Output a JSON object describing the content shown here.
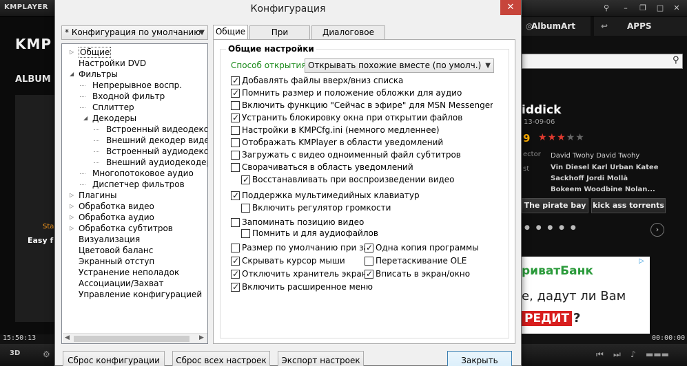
{
  "player": {
    "logo": "KMPLAYER",
    "big_logo": "KMP",
    "album_label": "ALBUM",
    "stat_text": "Sta",
    "easy_text": "Easy f",
    "time_left": "15:50:13",
    "time_right": "00:00:00",
    "tab_albumart": "AlbumArt",
    "tab_apps": "APPS",
    "movie_title": "iddick",
    "movie_date": "13-09-06",
    "rating": "9",
    "stars_on": 3,
    "stars_total": 5,
    "director_label": "ector",
    "director_value": "David Twohy David Twohy",
    "cast_label": "st",
    "cast_value": "Vin Diesel Karl Urban Katee Sackhoff Jordi Mollà Bokeem Woodbine Nolan...",
    "link_piratebay": "The pirate bay",
    "link_kat": "kick ass torrents",
    "ad_bank": "риватБанк",
    "ad_line1": "е, дадут ли Вам",
    "ad_credit": "РЕДИТ",
    "ad_q": "?",
    "ctrl_3d": "3D"
  },
  "dialog": {
    "title": "Конфигурация",
    "close_glyph": "✕",
    "preset": "* Конфигурация по умолчанию",
    "tree": [
      {
        "label": "Общие",
        "level": 0,
        "toggle": "▷"
      },
      {
        "label": "Настройки DVD",
        "level": 0,
        "toggle": ""
      },
      {
        "label": "Фильтры",
        "level": 0,
        "toggle": "◢"
      },
      {
        "label": "Непрерывное воспр.",
        "level": 1,
        "toggle": ""
      },
      {
        "label": "Входной фильтр",
        "level": 1,
        "toggle": ""
      },
      {
        "label": "Сплиттер",
        "level": 1,
        "toggle": ""
      },
      {
        "label": "Декодеры",
        "level": 1,
        "toggle": "◢"
      },
      {
        "label": "Встроенный видеодекоде",
        "level": 2,
        "toggle": ""
      },
      {
        "label": "Внешний декодер видео",
        "level": 2,
        "toggle": ""
      },
      {
        "label": "Встроенный аудиодекоде",
        "level": 2,
        "toggle": ""
      },
      {
        "label": "Внешний аудиодекодер",
        "level": 2,
        "toggle": ""
      },
      {
        "label": "Многопотоковое аудио",
        "level": 1,
        "toggle": ""
      },
      {
        "label": "Диспетчер фильтров",
        "level": 1,
        "toggle": ""
      },
      {
        "label": "Плагины",
        "level": 0,
        "toggle": "▷"
      },
      {
        "label": "Обработка видео",
        "level": 0,
        "toggle": "▷"
      },
      {
        "label": "Обработка аудио",
        "level": 0,
        "toggle": "▷"
      },
      {
        "label": "Обработка субтитров",
        "level": 0,
        "toggle": "▷"
      },
      {
        "label": "Визуализация",
        "level": 0,
        "toggle": ""
      },
      {
        "label": "Цветовой баланс",
        "level": 0,
        "toggle": ""
      },
      {
        "label": "Экранный отступ",
        "level": 0,
        "toggle": ""
      },
      {
        "label": "Устранение неполадок",
        "level": 0,
        "toggle": ""
      },
      {
        "label": "Ассоциации/Захват",
        "level": 0,
        "toggle": ""
      },
      {
        "label": "Управление конфигурацией",
        "level": 0,
        "toggle": ""
      }
    ],
    "tabs": [
      "Общие",
      "При запуске...",
      "Диалоговое окно"
    ],
    "group_title": "Общие настройки",
    "open_mode_label": "Способ открытия:",
    "open_mode_value": "Открывать похожие вместе (по умолч.)",
    "checkboxes": [
      {
        "label": "Добавлять файлы вверх/вниз списка",
        "checked": true
      },
      {
        "label": "Помнить размер и положение обложки для аудио",
        "checked": true
      },
      {
        "label": "Включить функцию \"Сейчас в эфире\" для MSN Messenger",
        "checked": false
      },
      {
        "label": "Устранить блокировку окна при открытии файлов",
        "checked": true
      },
      {
        "label": "Настройки в KMPCfg.ini (немного медленнее)",
        "checked": false
      },
      {
        "label": "Отображать KMPlayer в области уведомлений",
        "checked": false
      },
      {
        "label": "Загружать с видео одноименный файл субтитров",
        "checked": false
      },
      {
        "label": "Сворачиваться в область уведомлений",
        "checked": false
      },
      {
        "label": "Восстанавливать при воспроизведении видео",
        "checked": true
      },
      {
        "label": "Поддержка мультимедийных клавиатур",
        "checked": true
      },
      {
        "label": "Включить регулятор громкости",
        "checked": false
      },
      {
        "label": "Запоминать позицию видео",
        "checked": false
      },
      {
        "label": "Помнить и для аудиофайлов",
        "checked": false
      },
      {
        "label": "Размер по умолчанию при закр",
        "checked": false
      },
      {
        "label": "Одна копия программы",
        "checked": true
      },
      {
        "label": "Скрывать курсор мыши",
        "checked": true
      },
      {
        "label": "Перетаскивание OLE",
        "checked": false
      },
      {
        "label": "Отключить хранитель экрана",
        "checked": true
      },
      {
        "label": "Вписать в экран/окно",
        "checked": true
      },
      {
        "label": "Включить расширенное меню",
        "checked": true
      }
    ],
    "buttons": {
      "reset_config": "Сброс конфигурации",
      "reset_all": "Сброс всех настроек",
      "export": "Экспорт настроек",
      "close": "Закрыть"
    }
  }
}
